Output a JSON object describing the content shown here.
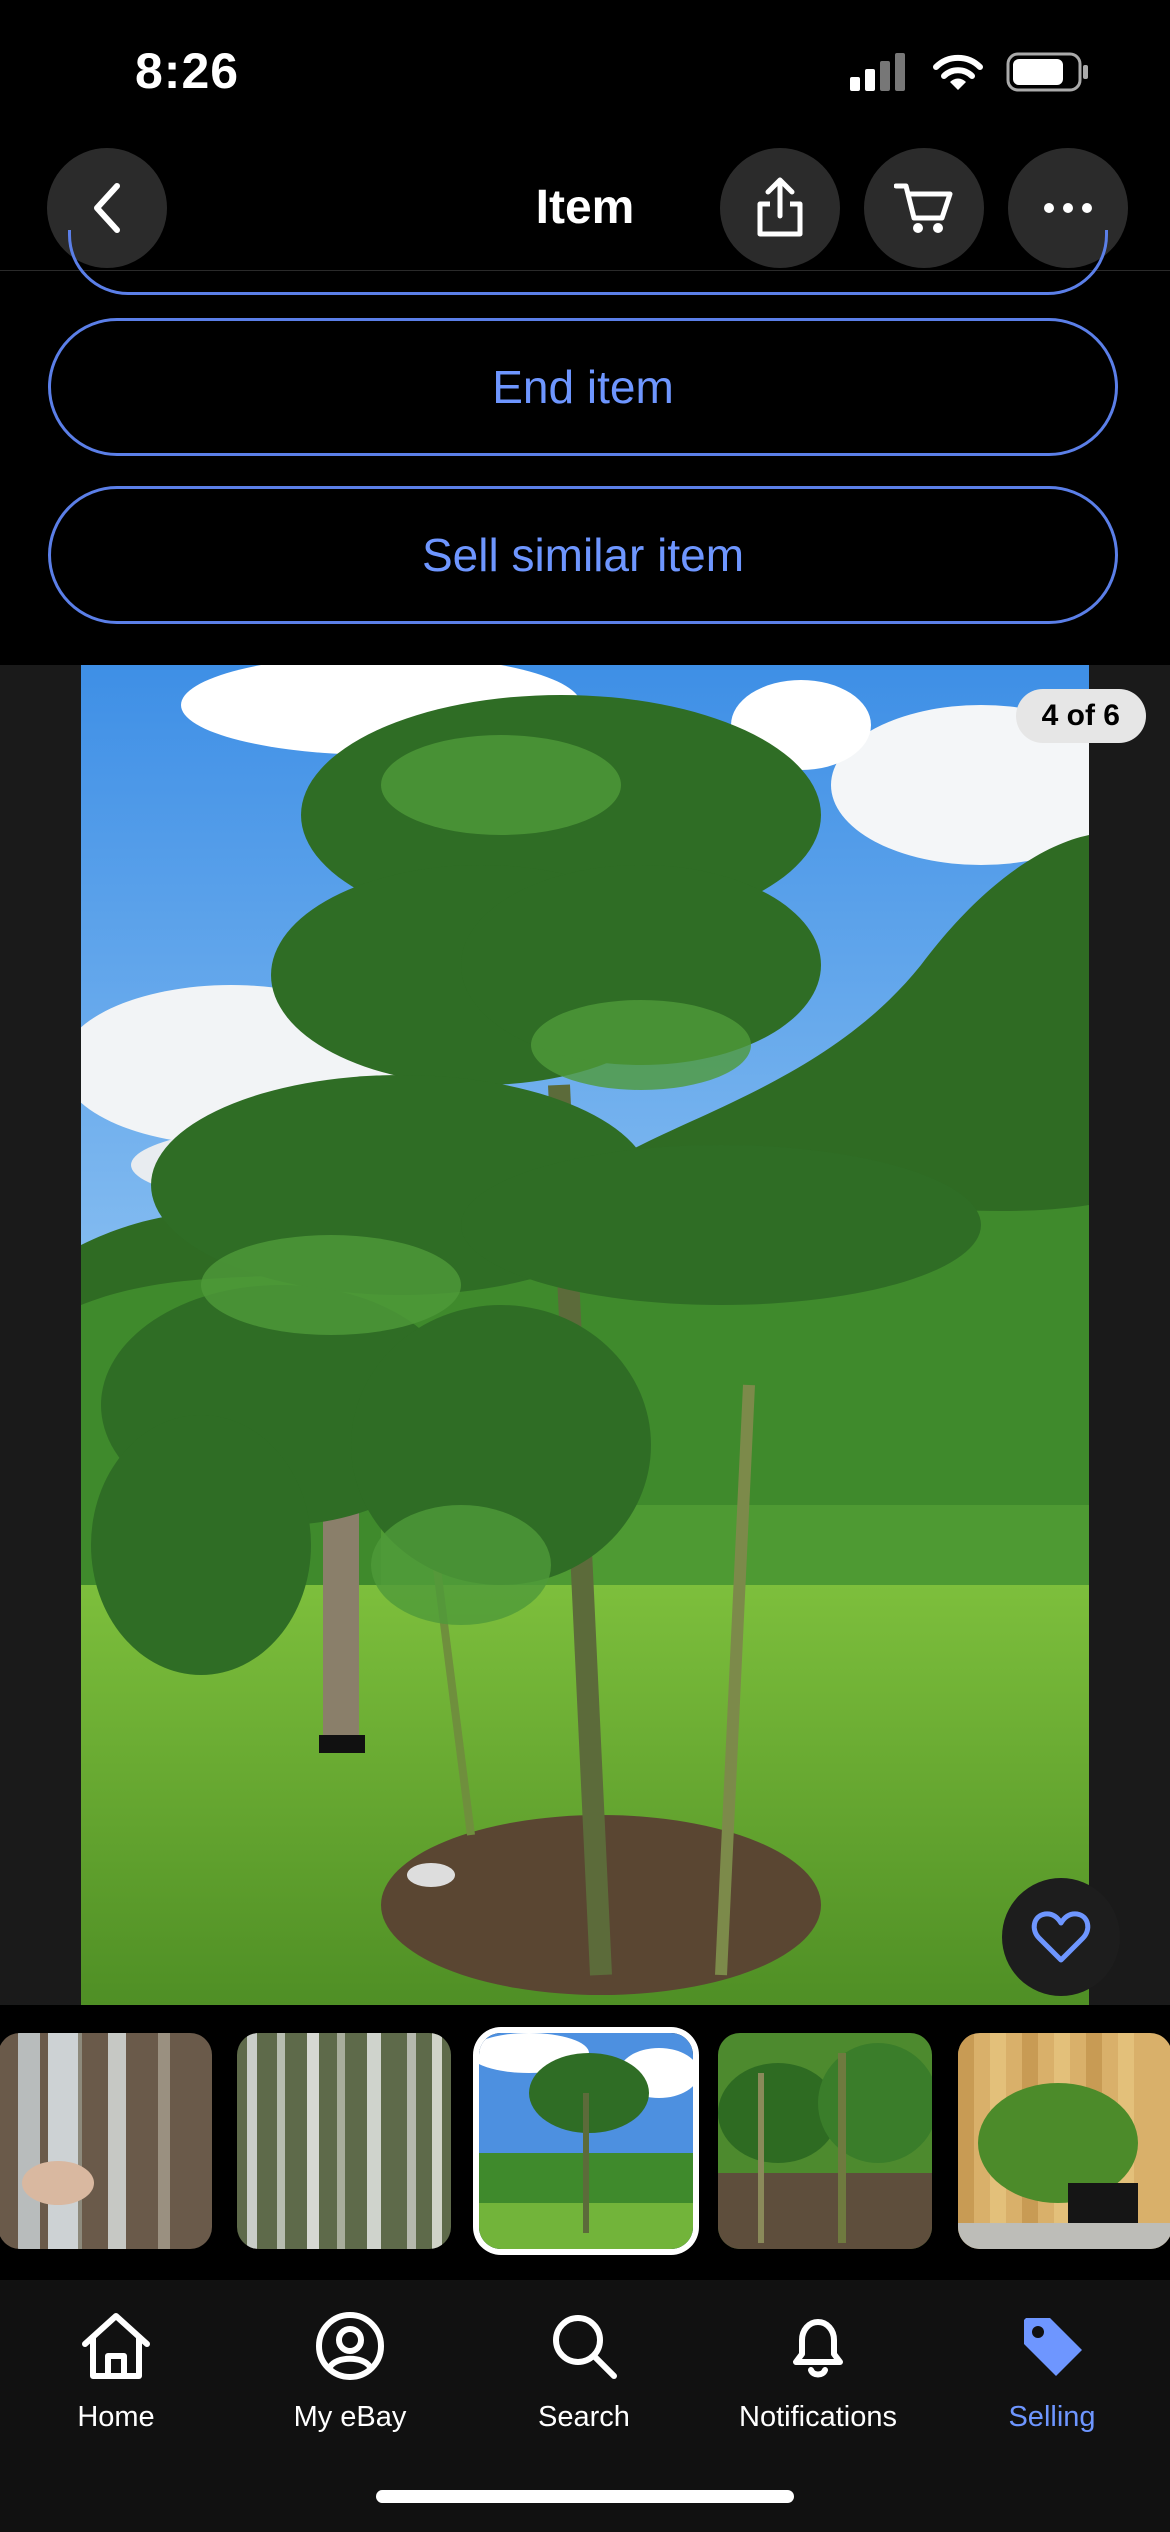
{
  "status": {
    "time": "8:26"
  },
  "nav": {
    "title": "Item"
  },
  "actions": {
    "end_item": "End item",
    "sell_similar": "Sell similar item"
  },
  "gallery": {
    "counter": "4 of 6"
  },
  "tabs": [
    {
      "label": "Home",
      "icon": "home-icon"
    },
    {
      "label": "My eBay",
      "icon": "user-circle-icon"
    },
    {
      "label": "Search",
      "icon": "search-icon"
    },
    {
      "label": "Notifications",
      "icon": "bell-icon"
    },
    {
      "label": "Selling",
      "icon": "tag-icon"
    }
  ],
  "colors": {
    "accent": "#6e96ff",
    "outline": "#5b7fe8",
    "background": "#000000"
  }
}
